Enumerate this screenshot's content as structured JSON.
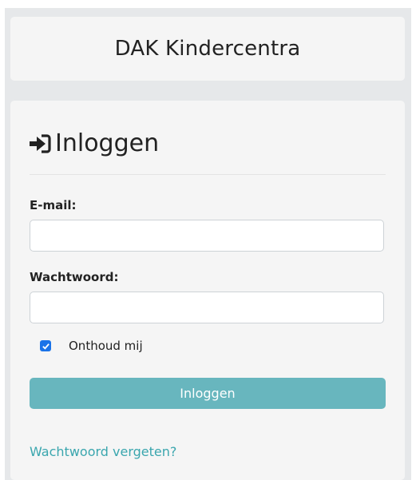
{
  "header": {
    "brand": "DAK Kindercentra"
  },
  "login": {
    "title": "Inloggen",
    "title_icon": "sign-in-icon",
    "email_label": "E-mail:",
    "email_value": "",
    "password_label": "Wachtwoord:",
    "password_value": "",
    "remember_label": "Onthoud mij",
    "remember_checked": true,
    "submit_label": "Inloggen",
    "forgot_link": "Wachtwoord vergeten?"
  },
  "colors": {
    "accent": "#68b6be",
    "link": "#3aa6ae",
    "checkbox": "#1a73e8",
    "card_background": "#f5f5f5",
    "page_background": "#e6e8ea"
  }
}
